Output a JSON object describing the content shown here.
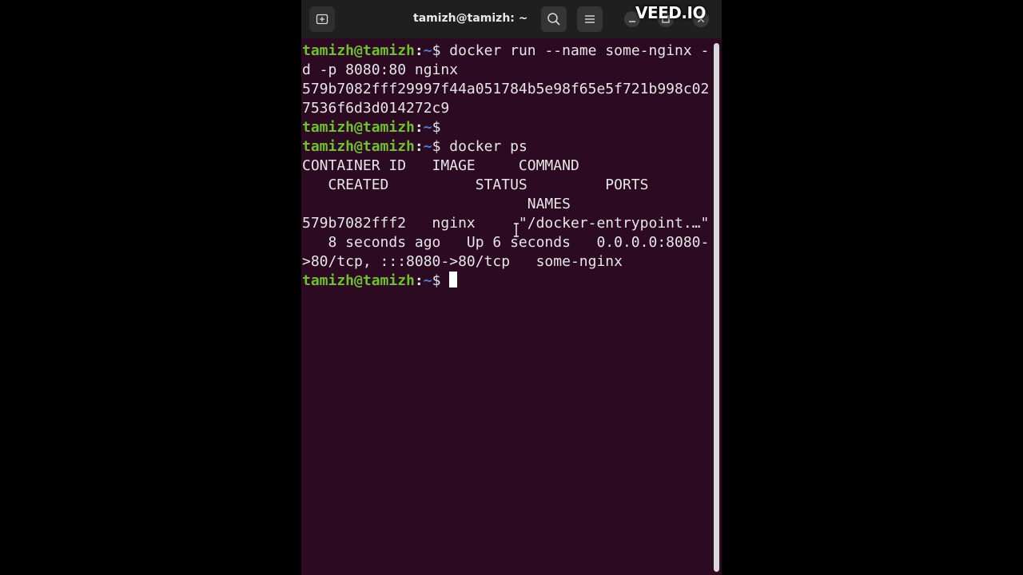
{
  "window": {
    "title": "tamizh@tamizh: ~",
    "watermark": "VEED.IO"
  },
  "prompt": {
    "user": "tamizh@tamizh",
    "sep": ":",
    "path": "~",
    "dollar": "$ "
  },
  "commands": {
    "run": "docker run --name some-nginx -",
    "run_cont": "d -p 8080:80 nginx",
    "ps": "docker ps"
  },
  "output": {
    "container_id_1": "579b7082fff29997f44a051784b5e98f65e5f721b998c02",
    "container_id_2": "7536f6d3d014272c9",
    "header_1": "CONTAINER ID   IMAGE     COMMAND",
    "header_2": "   CREATED          STATUS         PORTS",
    "header_3": "                          NAMES",
    "row_1": "579b7082fff2   nginx     \"/docker-entrypoint.…\"",
    "row_2": "   8 seconds ago   Up 6 seconds   0.0.0.0:8080-",
    "row_3": ">80/tcp, :::8080->80/tcp   some-nginx"
  },
  "colors": {
    "terminal_bg": "#2c0b22",
    "titlebar_bg": "#1f1f1f",
    "prompt_user": "#6fc030",
    "prompt_path": "#4a7fd4"
  },
  "icons": {
    "new_tab": "new-tab-icon",
    "search": "search-icon",
    "menu": "hamburger-menu-icon",
    "minimize": "minimize-icon",
    "maximize": "maximize-icon",
    "close": "close-icon"
  }
}
